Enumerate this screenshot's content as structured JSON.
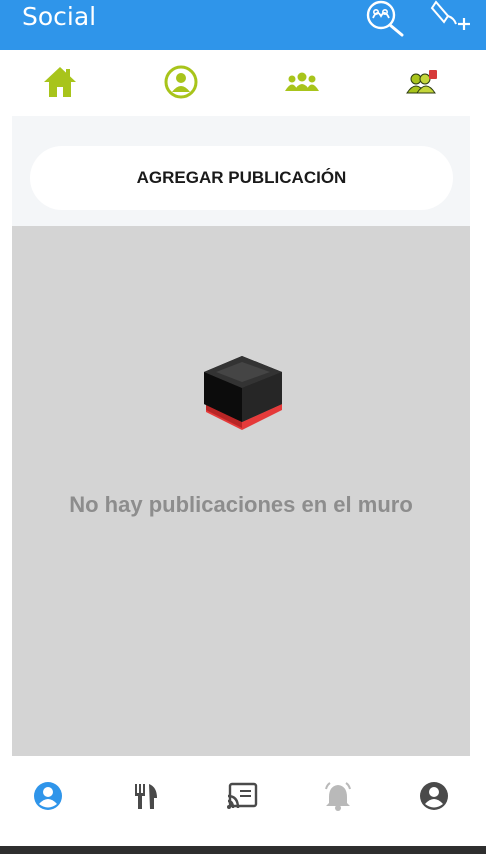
{
  "app_bar": {
    "title": "Social",
    "actions": [
      {
        "icon": "search-friends-icon"
      },
      {
        "icon": "add-friend-icon"
      }
    ],
    "background": "#2f95ea"
  },
  "top_tabs": [
    {
      "icon": "home-icon"
    },
    {
      "icon": "profile-icon"
    },
    {
      "icon": "friends-group-icon"
    },
    {
      "icon": "friend-requests-icon"
    }
  ],
  "accent_color": "#a8c41b",
  "add_post": {
    "label": "AGREGAR PUBLICACIÓN"
  },
  "wall": {
    "empty_message": "No hay publicaciones en el muro"
  },
  "bottom_nav": [
    {
      "icon": "social-user-icon",
      "active": true
    },
    {
      "icon": "food-icon",
      "active": false
    },
    {
      "icon": "cast-icon",
      "active": false
    },
    {
      "icon": "notifications-icon",
      "active": false
    },
    {
      "icon": "account-icon",
      "active": false
    }
  ]
}
